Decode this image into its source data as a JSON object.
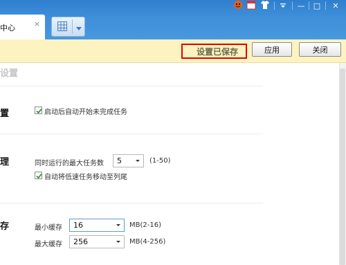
{
  "tab": {
    "label": "中心",
    "close": "×"
  },
  "window_controls": {
    "minimize": "—",
    "maximize": "□",
    "close": "✕"
  },
  "notice": {
    "saved_text": "设置已保存",
    "apply_label": "应用",
    "close_label": "关闭"
  },
  "sections": {
    "faded_title": "设置",
    "startup": {
      "title": "置",
      "auto_start": {
        "label": "启动后自动开始未完成任务",
        "checked": true
      }
    },
    "tasks": {
      "title": "理",
      "max_tasks": {
        "label": "同时运行的最大任务数",
        "value": "5",
        "range": "(1-50)"
      },
      "slow_to_tail": {
        "label": "自动将低速任务移动至列尾",
        "checked": true
      }
    },
    "cache": {
      "title": "存",
      "min_cache": {
        "label": "最小缓存",
        "value": "16",
        "unit": "MB(2-16)"
      },
      "max_cache": {
        "label": "最大缓存",
        "value": "256",
        "unit": "MB(4-256)"
      }
    }
  },
  "colors": {
    "titlebar": "#3f8fd9",
    "notice_bg": "#fdf3c0",
    "highlight_box": "#e00000",
    "check": "#2a8a2a"
  }
}
